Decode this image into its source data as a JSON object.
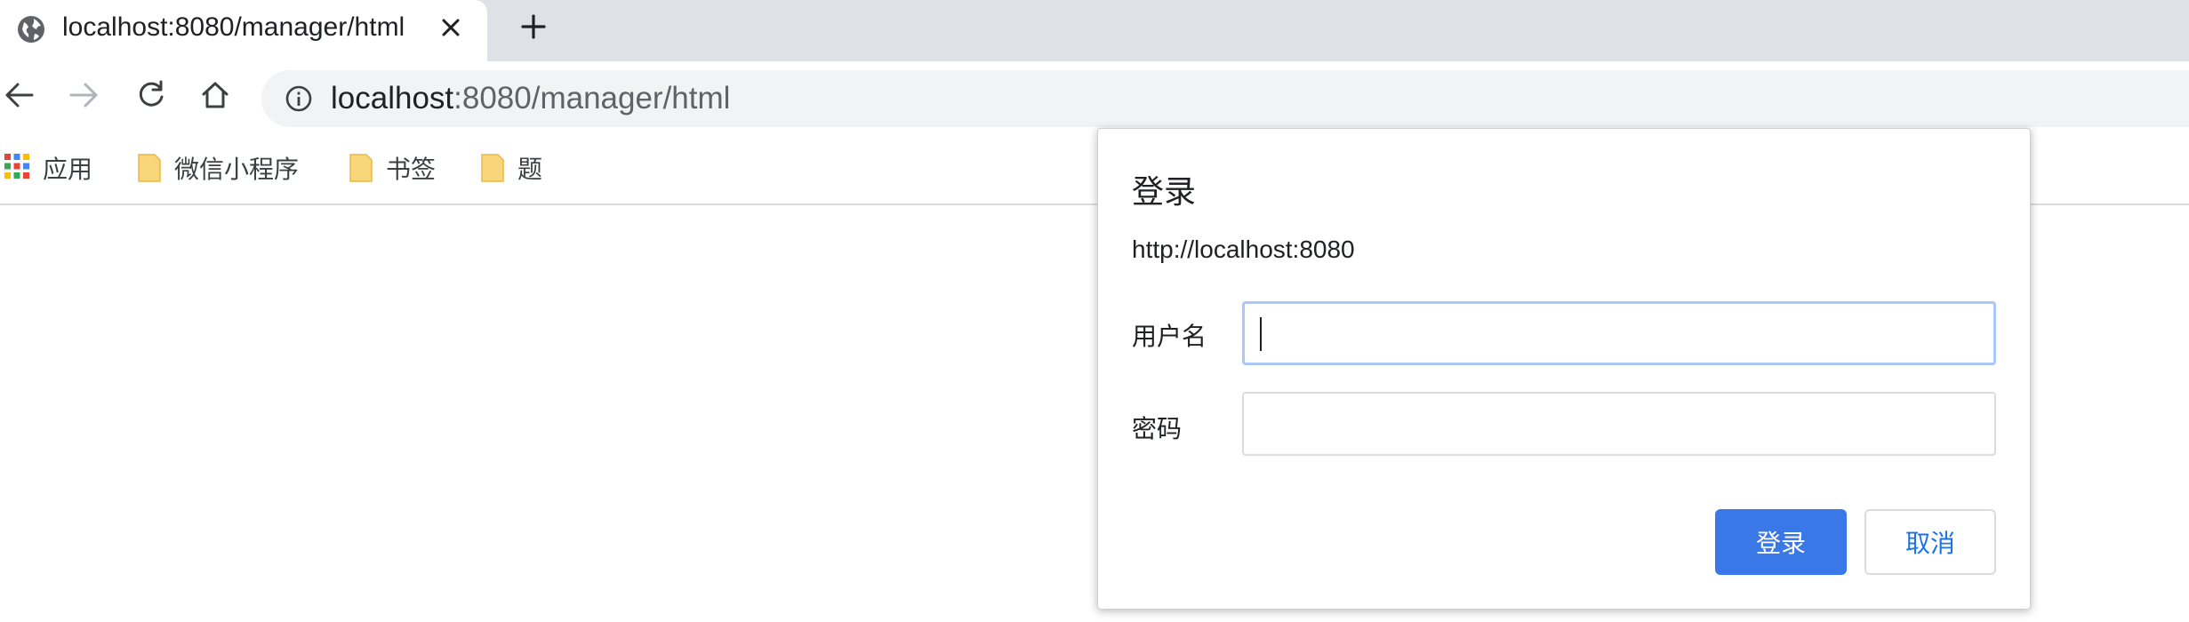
{
  "tab": {
    "title": "localhost:8080/manager/html",
    "favicon": "globe-icon",
    "close_icon": "close-icon",
    "new_tab_icon": "plus-icon"
  },
  "toolbar": {
    "back_icon": "back-arrow-icon",
    "forward_icon": "forward-arrow-icon",
    "reload_icon": "reload-icon",
    "home_icon": "home-icon",
    "info_icon": "info-icon",
    "url_host": "localhost",
    "url_rest": ":8080/manager/html"
  },
  "bookmarks": {
    "apps_label": "应用",
    "items": [
      {
        "label": "微信小程序",
        "icon": "folder-icon"
      },
      {
        "label": "书签",
        "icon": "folder-icon"
      },
      {
        "label": "题",
        "icon": "folder-icon"
      }
    ]
  },
  "dialog": {
    "title": "登录",
    "origin": "http://localhost:8080",
    "username_label": "用户名",
    "username_value": "",
    "password_label": "密码",
    "password_value": "",
    "login_button": "登录",
    "cancel_button": "取消"
  },
  "colors": {
    "tabstrip_bg": "#dee1e6",
    "omnibox_bg": "#f1f3f4",
    "primary_button": "#3b78e7",
    "focus_ring": "#a8c7fa",
    "cancel_text": "#1a73e8"
  }
}
